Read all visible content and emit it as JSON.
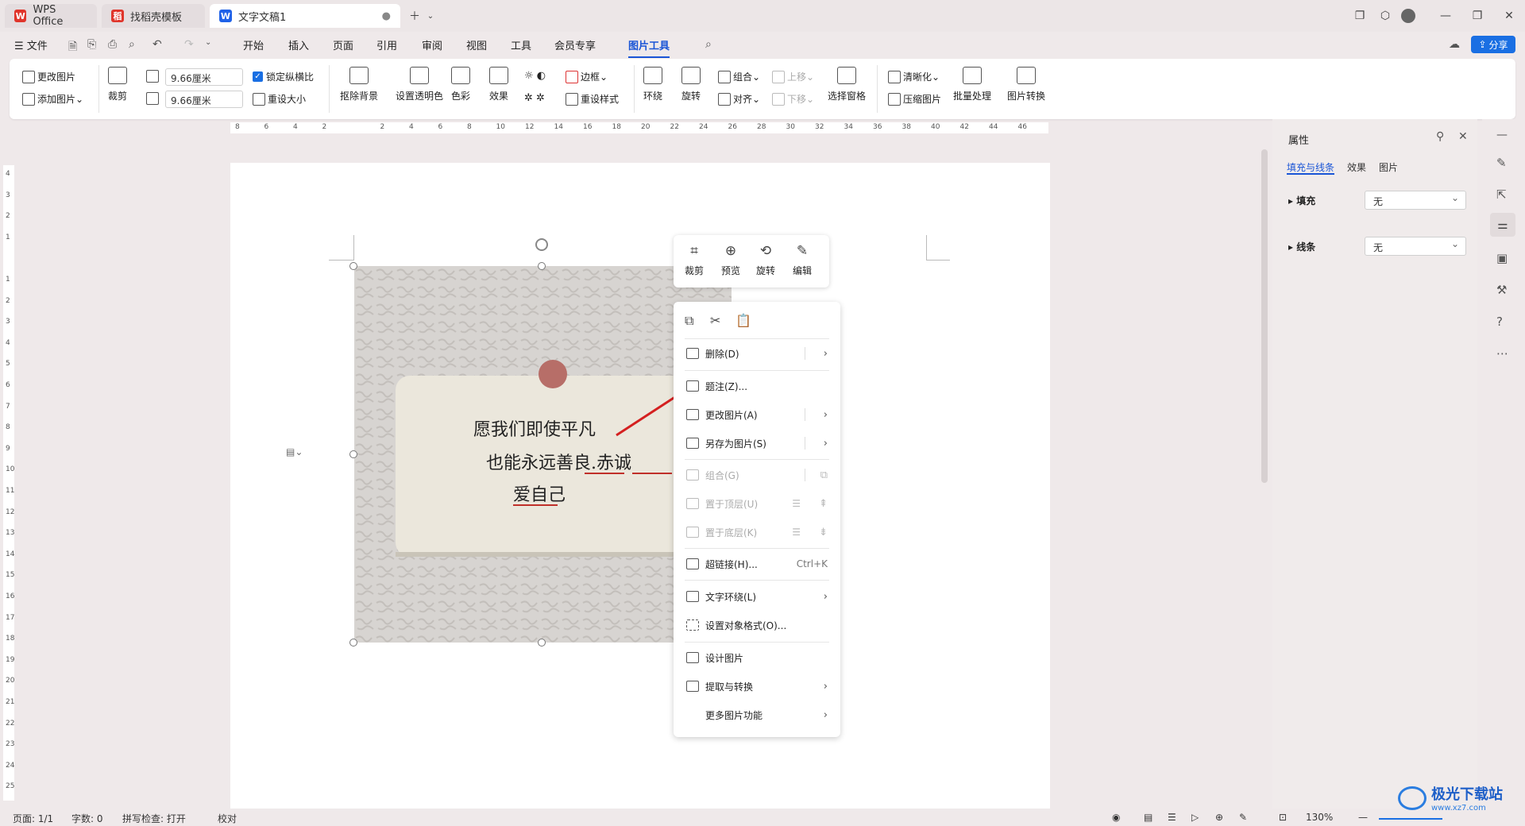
{
  "tabs": [
    {
      "label": "WPS Office",
      "icon": "wps-logo-icon",
      "color": "#e0352b"
    },
    {
      "label": "找稻壳模板",
      "icon": "docer-icon",
      "color": "#e0352b"
    },
    {
      "label": "文字文稿1",
      "icon": "writer-icon",
      "color": "#2062e8"
    }
  ],
  "menubar": {
    "file": "☰ 文件",
    "items": [
      "开始",
      "插入",
      "页面",
      "引用",
      "审阅",
      "视图",
      "工具",
      "会员专享",
      "图片工具"
    ],
    "active": "图片工具",
    "share": "分享"
  },
  "ribbon": {
    "change_picture": "更改图片",
    "add_picture": "添加图片",
    "crop": "裁剪",
    "width": "9.66厘米",
    "height": "9.66厘米",
    "lock_ratio": "锁定纵横比",
    "reset_size": "重设大小",
    "remove_bg": "抠除背景",
    "set_transparent": "设置透明色",
    "color": "色彩",
    "effects": "效果",
    "border": "边框",
    "reset_style": "重设样式",
    "wrap": "环绕",
    "rotate": "旋转",
    "group": "组合",
    "align": "对齐",
    "bring_forward": "上移",
    "send_backward": "下移",
    "selection_pane": "选择窗格",
    "sharpen": "清晰化",
    "compress": "压缩图片",
    "batch": "批量处理",
    "convert": "图片转换"
  },
  "ruler_h": [
    "8",
    "6",
    "4",
    "2",
    "",
    "2",
    "4",
    "6",
    "8",
    "10",
    "12",
    "14",
    "16",
    "18",
    "20",
    "22",
    "24",
    "26",
    "28",
    "30",
    "32",
    "34",
    "36",
    "38",
    "40",
    "42",
    "44",
    "46"
  ],
  "ruler_v": [
    "4",
    "3",
    "2",
    "1",
    "",
    "1",
    "2",
    "3",
    "4",
    "5",
    "6",
    "7",
    "8",
    "9",
    "10",
    "11",
    "12",
    "13",
    "14",
    "15",
    "16",
    "17",
    "18",
    "19",
    "20",
    "21",
    "22",
    "23",
    "24",
    "25"
  ],
  "picture": {
    "note_lines": [
      "愿我们即使平凡",
      "也能永远善良.赤诚",
      "爱自己"
    ]
  },
  "float_toolbar": [
    {
      "label": "裁剪",
      "icon": "crop-icon"
    },
    {
      "label": "预览",
      "icon": "zoom-in-icon"
    },
    {
      "label": "旋转",
      "icon": "rotate-icon"
    },
    {
      "label": "编辑",
      "icon": "edit-picture-icon"
    }
  ],
  "context_menu": {
    "delete": "删除(D)",
    "caption": "题注(Z)...",
    "change_picture": "更改图片(A)",
    "save_as_picture": "另存为图片(S)",
    "group": "组合(G)",
    "bring_to_front": "置于顶层(U)",
    "send_to_back": "置于底层(K)",
    "hyperlink": "超链接(H)...",
    "hyperlink_shortcut": "Ctrl+K",
    "text_wrap": "文字环绕(L)",
    "format_object": "设置对象格式(O)...",
    "design_picture": "设计图片",
    "extract_convert": "提取与转换",
    "more_functions": "更多图片功能"
  },
  "panel": {
    "title": "属性",
    "tabs": [
      "填充与线条",
      "效果",
      "图片"
    ],
    "fill_label": "填充",
    "fill_value": "无",
    "line_label": "线条",
    "line_value": "无"
  },
  "status": {
    "page": "页面: 1/1",
    "words": "字数: 0",
    "spell": "拼写检查: 打开",
    "proof": "校对",
    "zoom": "130%"
  },
  "watermark": "极光下载站",
  "watermark_url": "www.xz7.com"
}
